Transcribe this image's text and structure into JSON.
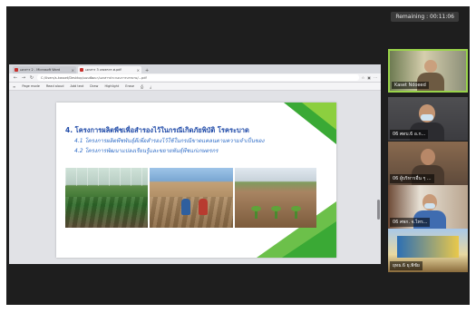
{
  "timer": {
    "label": "Remaining : 00:11:06"
  },
  "browser": {
    "tabs": [
      {
        "label": "เอกสาร 2 - Microsoft Word"
      },
      {
        "label": "เอกสาร 3 เกษตรกร ศ.pdf"
      }
    ],
    "new_tab_icon": "plus-icon",
    "url": "C:/Users/s-kasset/Desktop/แผนพัฒนา/เอกสารประกอบการบรรยาย/...pdf",
    "pdf_toolbar": [
      "Page mode",
      "Read aloud",
      "Add text",
      "Draw",
      "Highlight",
      "Erase"
    ]
  },
  "slide": {
    "title": "4. โครงการผลิตพืชเพื่อสำรองไว้ในกรณีเกิดภัยพิบัติ โรคระบาด",
    "line1": "4.1 โครงการผลิตพืชพันธุ์ดีเพื่อสำรองไว้ใช้ในกรณีขาดแคลนตามความจำเป็นของ",
    "line2": "4.2 โครงการพัฒนาแปลงเรียนรู้และขยายพันธุ์พืชแก่เกษตรกร",
    "accent_colors": [
      "#3aa935",
      "#8ccf3f",
      "#6cc04a"
    ]
  },
  "participants": [
    {
      "name": "Kaset Ndoeed"
    },
    {
      "name": "06 ศดบ.6 อ.ก..."
    },
    {
      "name": "06 ผู้บริหารอื่น ๆ ..."
    },
    {
      "name": "06 ศพก. จ.ไทร..."
    },
    {
      "name": "ยุทธ.6 ยุ.พิชัย"
    }
  ]
}
